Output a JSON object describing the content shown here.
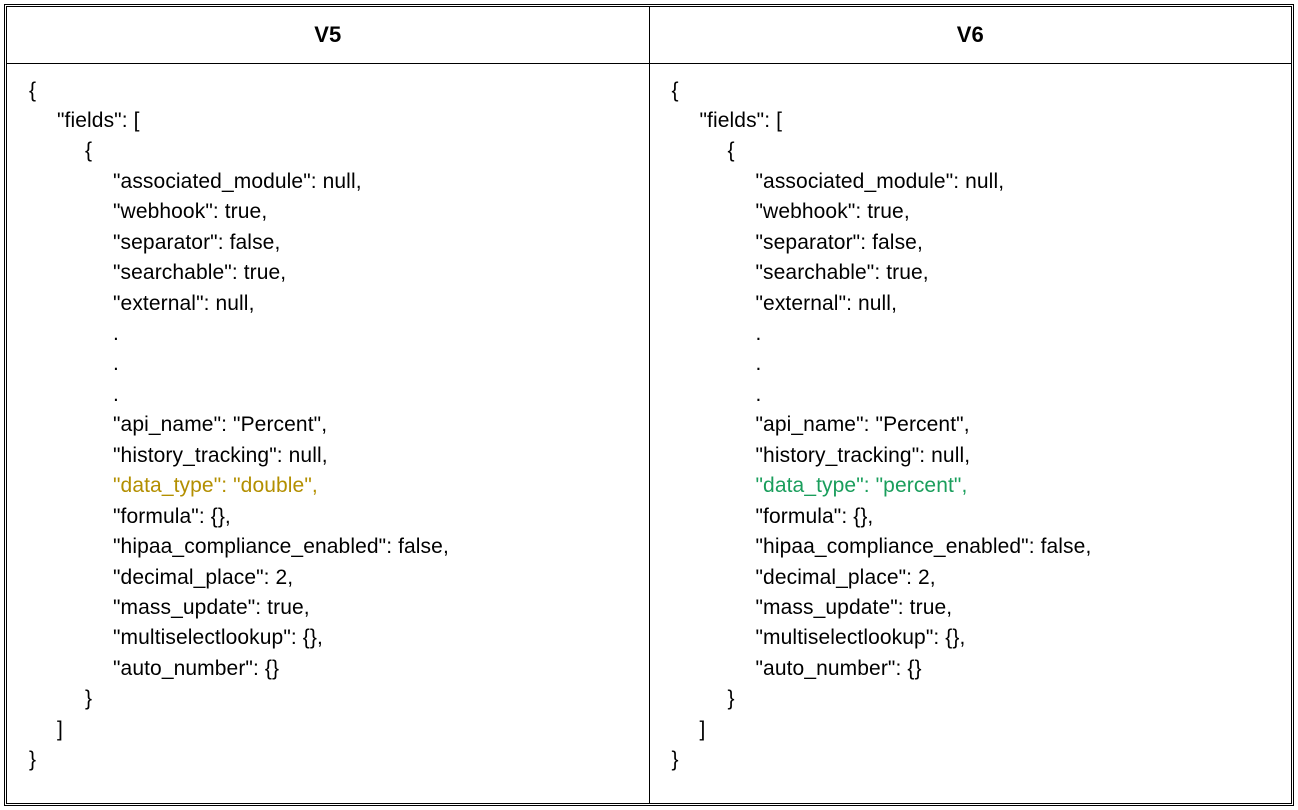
{
  "headers": {
    "left": "V5",
    "right": "V6"
  },
  "highlight_colors": {
    "left": "#b38f00",
    "right": "#1a9e5c"
  },
  "left": {
    "lines": [
      {
        "indent": 0,
        "text": "{"
      },
      {
        "indent": 1,
        "text": "\"fields\": ["
      },
      {
        "indent": 2,
        "text": "{"
      },
      {
        "indent": 3,
        "text": "\"associated_module\": null,"
      },
      {
        "indent": 3,
        "text": "\"webhook\": true,"
      },
      {
        "indent": 3,
        "text": "\"separator\": false,"
      },
      {
        "indent": 3,
        "text": "\"searchable\": true,"
      },
      {
        "indent": 3,
        "text": "\"external\": null,"
      },
      {
        "indent": 3,
        "text": "."
      },
      {
        "indent": 3,
        "text": "."
      },
      {
        "indent": 3,
        "text": "."
      },
      {
        "indent": 3,
        "text": "\"api_name\": \"Percent\","
      },
      {
        "indent": 3,
        "text": "\"history_tracking\": null,"
      },
      {
        "indent": 3,
        "text": "\"data_type\": \"double\",",
        "highlight": true
      },
      {
        "indent": 3,
        "text": "\"formula\": {},"
      },
      {
        "indent": 3,
        "text": "\"hipaa_compliance_enabled\": false,"
      },
      {
        "indent": 3,
        "text": "\"decimal_place\": 2,"
      },
      {
        "indent": 3,
        "text": "\"mass_update\": true,"
      },
      {
        "indent": 3,
        "text": "\"multiselectlookup\": {},"
      },
      {
        "indent": 3,
        "text": "\"auto_number\": {}"
      },
      {
        "indent": 2,
        "text": "}"
      },
      {
        "indent": 1,
        "text": "]"
      },
      {
        "indent": 0,
        "text": "}"
      }
    ]
  },
  "right": {
    "lines": [
      {
        "indent": 0,
        "text": "{"
      },
      {
        "indent": 1,
        "text": "\"fields\": ["
      },
      {
        "indent": 2,
        "text": "{"
      },
      {
        "indent": 3,
        "text": "\"associated_module\": null,"
      },
      {
        "indent": 3,
        "text": "\"webhook\": true,"
      },
      {
        "indent": 3,
        "text": "\"separator\": false,"
      },
      {
        "indent": 3,
        "text": "\"searchable\": true,"
      },
      {
        "indent": 3,
        "text": "\"external\": null,"
      },
      {
        "indent": 3,
        "text": "."
      },
      {
        "indent": 3,
        "text": "."
      },
      {
        "indent": 3,
        "text": "."
      },
      {
        "indent": 3,
        "text": "\"api_name\": \"Percent\","
      },
      {
        "indent": 3,
        "text": "\"history_tracking\": null,"
      },
      {
        "indent": 3,
        "text": "\"data_type\": \"percent\",",
        "highlight": true
      },
      {
        "indent": 3,
        "text": "\"formula\": {},"
      },
      {
        "indent": 3,
        "text": "\"hipaa_compliance_enabled\": false,"
      },
      {
        "indent": 3,
        "text": "\"decimal_place\": 2,"
      },
      {
        "indent": 3,
        "text": "\"mass_update\": true,"
      },
      {
        "indent": 3,
        "text": "\"multiselectlookup\": {},"
      },
      {
        "indent": 3,
        "text": "\"auto_number\": {}"
      },
      {
        "indent": 2,
        "text": "}"
      },
      {
        "indent": 1,
        "text": "]"
      },
      {
        "indent": 0,
        "text": "}"
      }
    ]
  }
}
